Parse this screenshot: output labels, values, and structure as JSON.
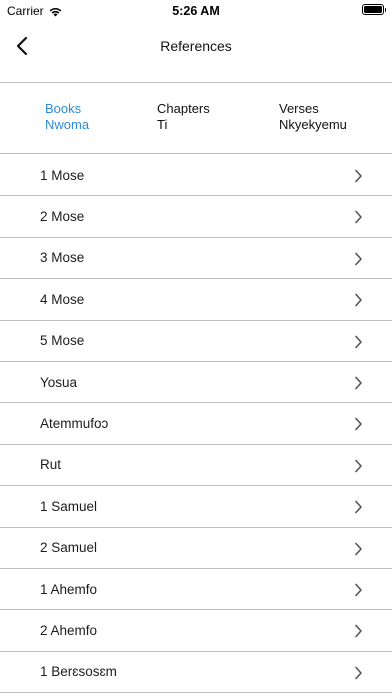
{
  "status": {
    "carrier": "Carrier",
    "time": "5:26 AM"
  },
  "nav": {
    "title": "References"
  },
  "tabs": [
    {
      "line1": "Books",
      "line2": "Nwoma",
      "active": true
    },
    {
      "line1": "Chapters",
      "line2": "Ti",
      "active": false
    },
    {
      "line1": "Verses",
      "line2": "Nkyekyemu",
      "active": false
    }
  ],
  "books": [
    {
      "label": "1 Mose"
    },
    {
      "label": "2 Mose"
    },
    {
      "label": "3 Mose"
    },
    {
      "label": "4 Mose"
    },
    {
      "label": "5 Mose"
    },
    {
      "label": "Yosua"
    },
    {
      "label": "Atemmufoɔ"
    },
    {
      "label": "Rut"
    },
    {
      "label": "1 Samuel"
    },
    {
      "label": "2 Samuel"
    },
    {
      "label": "1 Ahemfo"
    },
    {
      "label": "2 Ahemfo"
    },
    {
      "label": "1 Berɛsosɛm"
    }
  ],
  "colors": {
    "accent": "#2e8bd8",
    "divider": "#bdbdbd",
    "chevron": "#555555"
  }
}
